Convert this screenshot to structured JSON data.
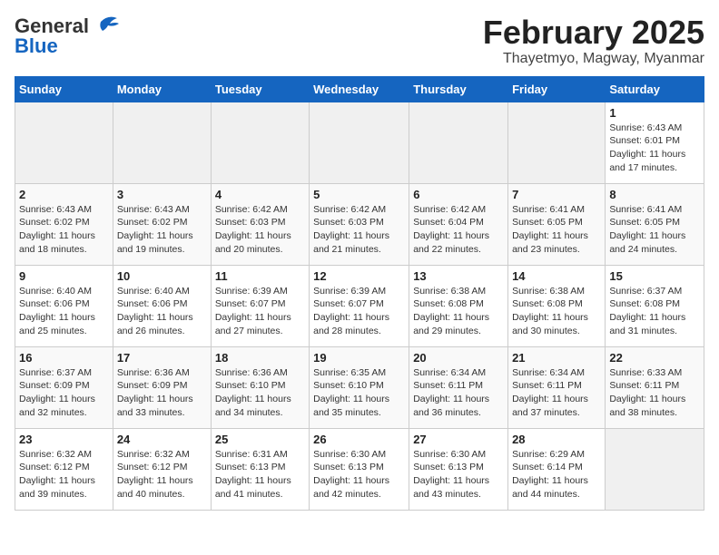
{
  "logo": {
    "general": "General",
    "blue": "Blue"
  },
  "title": "February 2025",
  "location": "Thayetmyo, Magway, Myanmar",
  "days_of_week": [
    "Sunday",
    "Monday",
    "Tuesday",
    "Wednesday",
    "Thursday",
    "Friday",
    "Saturday"
  ],
  "weeks": [
    [
      {
        "day": "",
        "info": ""
      },
      {
        "day": "",
        "info": ""
      },
      {
        "day": "",
        "info": ""
      },
      {
        "day": "",
        "info": ""
      },
      {
        "day": "",
        "info": ""
      },
      {
        "day": "",
        "info": ""
      },
      {
        "day": "1",
        "info": "Sunrise: 6:43 AM\nSunset: 6:01 PM\nDaylight: 11 hours and 17 minutes."
      }
    ],
    [
      {
        "day": "2",
        "info": "Sunrise: 6:43 AM\nSunset: 6:02 PM\nDaylight: 11 hours and 18 minutes."
      },
      {
        "day": "3",
        "info": "Sunrise: 6:43 AM\nSunset: 6:02 PM\nDaylight: 11 hours and 19 minutes."
      },
      {
        "day": "4",
        "info": "Sunrise: 6:42 AM\nSunset: 6:03 PM\nDaylight: 11 hours and 20 minutes."
      },
      {
        "day": "5",
        "info": "Sunrise: 6:42 AM\nSunset: 6:03 PM\nDaylight: 11 hours and 21 minutes."
      },
      {
        "day": "6",
        "info": "Sunrise: 6:42 AM\nSunset: 6:04 PM\nDaylight: 11 hours and 22 minutes."
      },
      {
        "day": "7",
        "info": "Sunrise: 6:41 AM\nSunset: 6:05 PM\nDaylight: 11 hours and 23 minutes."
      },
      {
        "day": "8",
        "info": "Sunrise: 6:41 AM\nSunset: 6:05 PM\nDaylight: 11 hours and 24 minutes."
      }
    ],
    [
      {
        "day": "9",
        "info": "Sunrise: 6:40 AM\nSunset: 6:06 PM\nDaylight: 11 hours and 25 minutes."
      },
      {
        "day": "10",
        "info": "Sunrise: 6:40 AM\nSunset: 6:06 PM\nDaylight: 11 hours and 26 minutes."
      },
      {
        "day": "11",
        "info": "Sunrise: 6:39 AM\nSunset: 6:07 PM\nDaylight: 11 hours and 27 minutes."
      },
      {
        "day": "12",
        "info": "Sunrise: 6:39 AM\nSunset: 6:07 PM\nDaylight: 11 hours and 28 minutes."
      },
      {
        "day": "13",
        "info": "Sunrise: 6:38 AM\nSunset: 6:08 PM\nDaylight: 11 hours and 29 minutes."
      },
      {
        "day": "14",
        "info": "Sunrise: 6:38 AM\nSunset: 6:08 PM\nDaylight: 11 hours and 30 minutes."
      },
      {
        "day": "15",
        "info": "Sunrise: 6:37 AM\nSunset: 6:08 PM\nDaylight: 11 hours and 31 minutes."
      }
    ],
    [
      {
        "day": "16",
        "info": "Sunrise: 6:37 AM\nSunset: 6:09 PM\nDaylight: 11 hours and 32 minutes."
      },
      {
        "day": "17",
        "info": "Sunrise: 6:36 AM\nSunset: 6:09 PM\nDaylight: 11 hours and 33 minutes."
      },
      {
        "day": "18",
        "info": "Sunrise: 6:36 AM\nSunset: 6:10 PM\nDaylight: 11 hours and 34 minutes."
      },
      {
        "day": "19",
        "info": "Sunrise: 6:35 AM\nSunset: 6:10 PM\nDaylight: 11 hours and 35 minutes."
      },
      {
        "day": "20",
        "info": "Sunrise: 6:34 AM\nSunset: 6:11 PM\nDaylight: 11 hours and 36 minutes."
      },
      {
        "day": "21",
        "info": "Sunrise: 6:34 AM\nSunset: 6:11 PM\nDaylight: 11 hours and 37 minutes."
      },
      {
        "day": "22",
        "info": "Sunrise: 6:33 AM\nSunset: 6:11 PM\nDaylight: 11 hours and 38 minutes."
      }
    ],
    [
      {
        "day": "23",
        "info": "Sunrise: 6:32 AM\nSunset: 6:12 PM\nDaylight: 11 hours and 39 minutes."
      },
      {
        "day": "24",
        "info": "Sunrise: 6:32 AM\nSunset: 6:12 PM\nDaylight: 11 hours and 40 minutes."
      },
      {
        "day": "25",
        "info": "Sunrise: 6:31 AM\nSunset: 6:13 PM\nDaylight: 11 hours and 41 minutes."
      },
      {
        "day": "26",
        "info": "Sunrise: 6:30 AM\nSunset: 6:13 PM\nDaylight: 11 hours and 42 minutes."
      },
      {
        "day": "27",
        "info": "Sunrise: 6:30 AM\nSunset: 6:13 PM\nDaylight: 11 hours and 43 minutes."
      },
      {
        "day": "28",
        "info": "Sunrise: 6:29 AM\nSunset: 6:14 PM\nDaylight: 11 hours and 44 minutes."
      },
      {
        "day": "",
        "info": ""
      }
    ]
  ]
}
